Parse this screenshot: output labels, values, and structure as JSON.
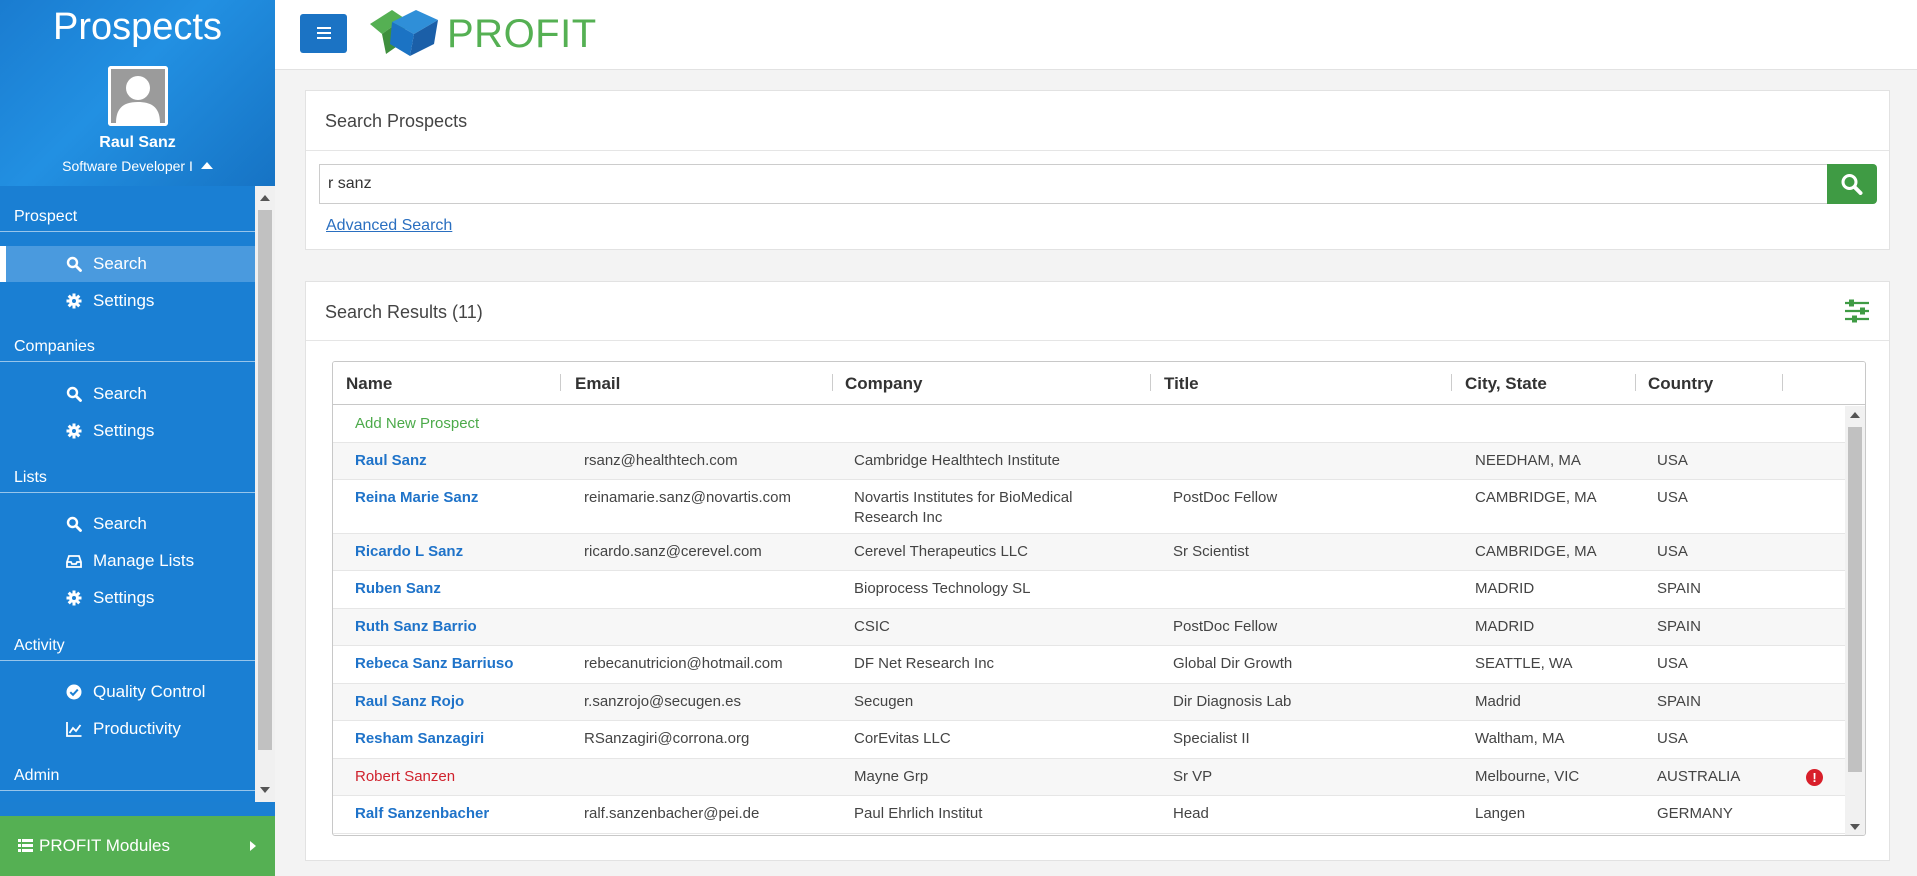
{
  "sidebar": {
    "title": "Prospects",
    "user_name": "Raul Sanz",
    "user_role": "Software Developer I",
    "sections": [
      {
        "label": "Prospect",
        "items": [
          {
            "label": "Search",
            "icon": "search-icon",
            "active": true
          },
          {
            "label": "Settings",
            "icon": "gear-icon"
          }
        ]
      },
      {
        "label": "Companies",
        "items": [
          {
            "label": "Search",
            "icon": "search-icon"
          },
          {
            "label": "Settings",
            "icon": "gear-icon"
          }
        ]
      },
      {
        "label": "Lists",
        "items": [
          {
            "label": "Search",
            "icon": "search-icon"
          },
          {
            "label": "Manage Lists",
            "icon": "inbox-icon"
          },
          {
            "label": "Settings",
            "icon": "gear-icon"
          }
        ]
      },
      {
        "label": "Activity",
        "items": [
          {
            "label": "Quality Control",
            "icon": "check-circle-icon"
          },
          {
            "label": "Productivity",
            "icon": "line-chart-icon"
          }
        ]
      },
      {
        "label": "Admin",
        "items": []
      }
    ],
    "modules_label": "PROFIT Modules"
  },
  "topbar": {
    "brand": "PROFIT"
  },
  "search": {
    "title": "Search Prospects",
    "query": "r sanz",
    "advanced_label": "Advanced Search"
  },
  "results": {
    "title": "Search Results (11)",
    "columns": [
      "Name",
      "Email",
      "Company",
      "Title",
      "City, State",
      "Country"
    ],
    "add_label": "Add New Prospect",
    "rows": [
      {
        "name": "Raul Sanz",
        "email": "rsanz@healthtech.com",
        "company": "Cambridge Healthtech Institute",
        "title": "",
        "city": "NEEDHAM, MA",
        "country": "USA"
      },
      {
        "name": "Reina Marie Sanz",
        "email": "reinamarie.sanz@novartis.com",
        "company": "Novartis Institutes for BioMedical Research Inc",
        "company_line1": "Novartis Institutes for BioMedical",
        "company_line2": "Research Inc",
        "title": "PostDoc Fellow",
        "city": "CAMBRIDGE, MA",
        "country": "USA"
      },
      {
        "name": "Ricardo L Sanz",
        "email": "ricardo.sanz@cerevel.com",
        "company": "Cerevel Therapeutics LLC",
        "title": "Sr Scientist",
        "city": "CAMBRIDGE, MA",
        "country": "USA"
      },
      {
        "name": "Ruben Sanz",
        "email": "",
        "company": "Bioprocess Technology SL",
        "title": "",
        "city": "MADRID",
        "country": "SPAIN"
      },
      {
        "name": "Ruth Sanz Barrio",
        "email": "",
        "company": "CSIC",
        "title": "PostDoc Fellow",
        "city": "MADRID",
        "country": "SPAIN"
      },
      {
        "name": "Rebeca Sanz Barriuso",
        "email": "rebecanutricion@hotmail.com",
        "company": "DF Net Research Inc",
        "title": "Global Dir Growth",
        "city": "SEATTLE, WA",
        "country": "USA"
      },
      {
        "name": "Raul Sanz Rojo",
        "email": "r.sanzrojo@secugen.es",
        "company": "Secugen",
        "title": "Dir Diagnosis Lab",
        "city": "Madrid",
        "country": "SPAIN"
      },
      {
        "name": "Resham Sanzagiri",
        "email": "RSanzagiri@corrona.org",
        "company": "CorEvitas LLC",
        "title": "Specialist II",
        "city": "Waltham, MA",
        "country": "USA"
      },
      {
        "name": "Robert Sanzen",
        "email": "",
        "company": "Mayne Grp",
        "title": "Sr VP",
        "city": "Melbourne, VIC",
        "country": "AUSTRALIA",
        "warning": "!"
      },
      {
        "name": "Ralf Sanzenbacher",
        "email": "ralf.sanzenbacher@pei.de",
        "company": "Paul Ehrlich Institut",
        "title": "Head",
        "city": "Langen",
        "country": "GERMANY"
      }
    ]
  },
  "colors": {
    "sidebar_blue": "#1b7fd2",
    "brand_green": "#55b053",
    "link_blue": "#1f73c9",
    "alert_red": "#d0232e"
  }
}
